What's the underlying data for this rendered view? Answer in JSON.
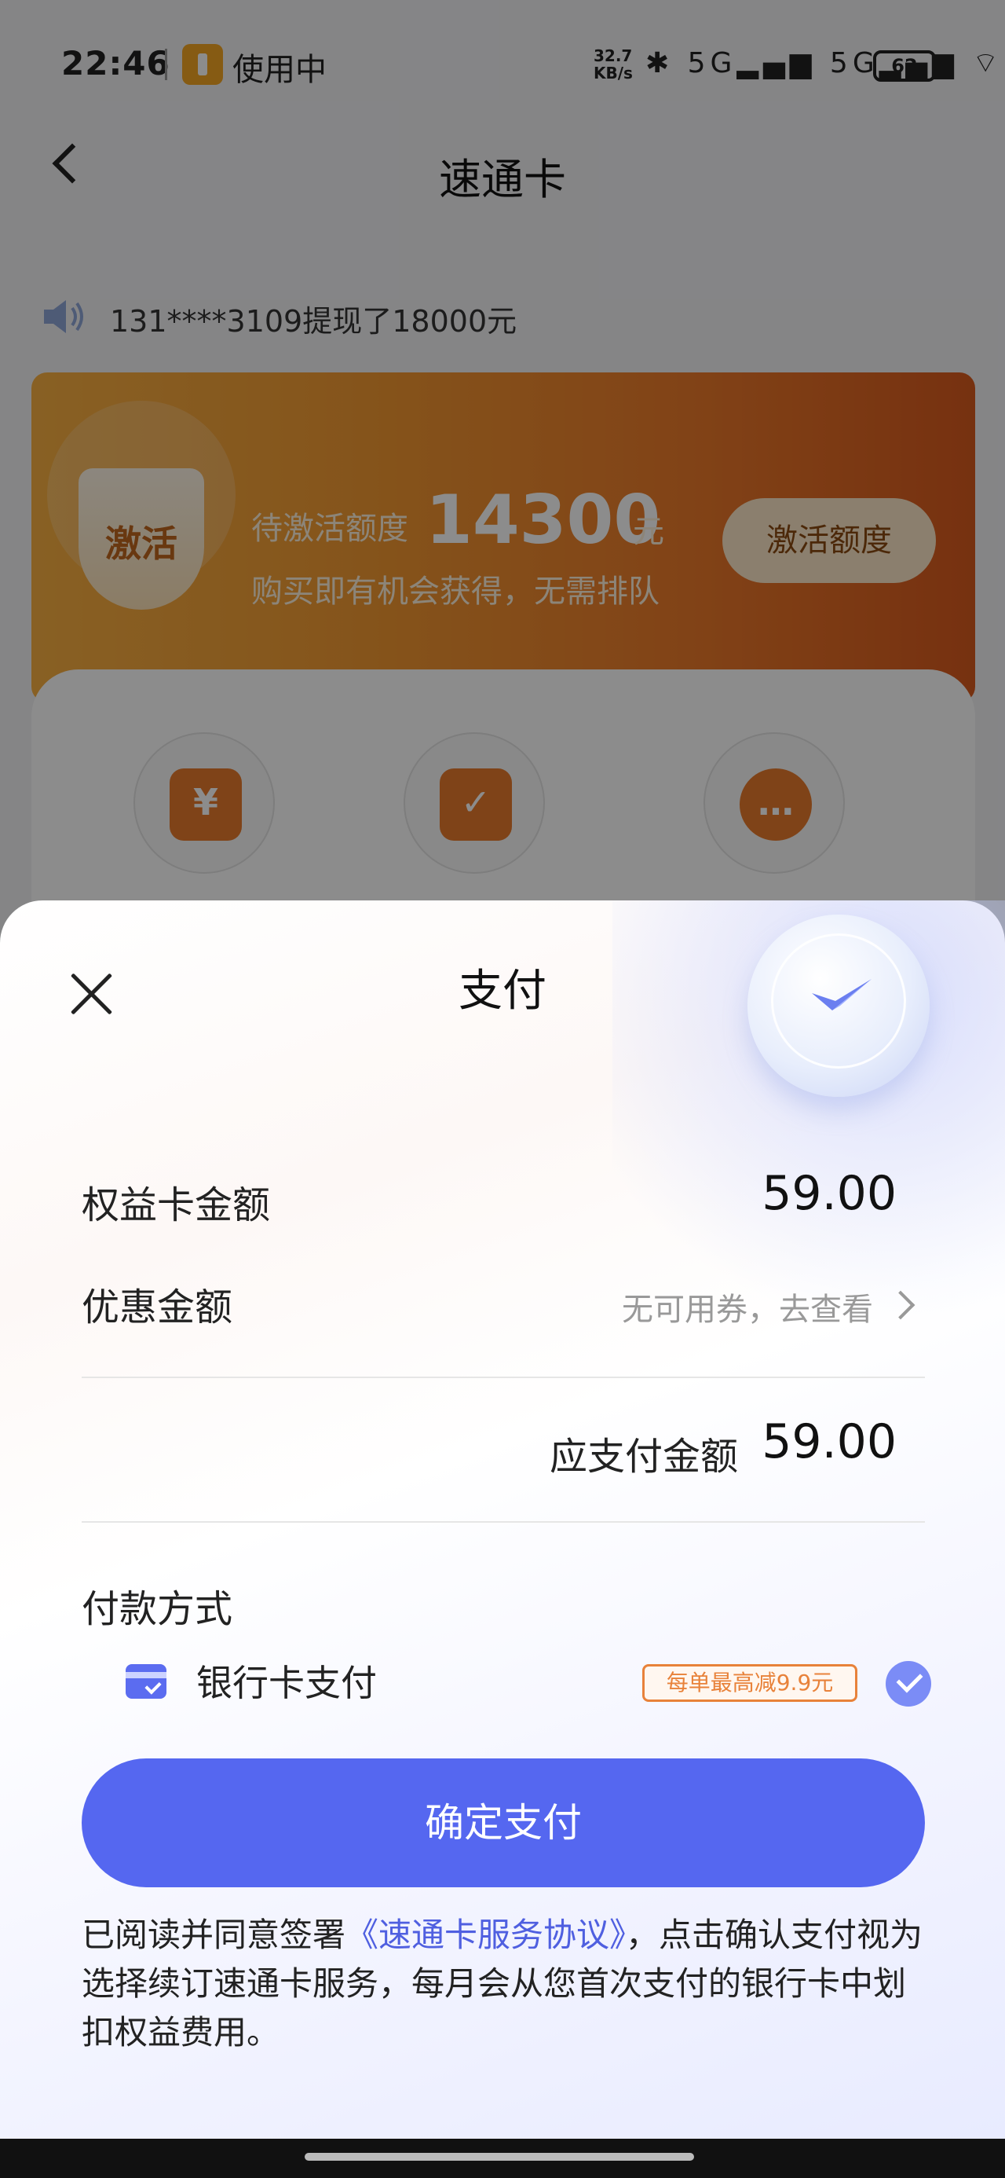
{
  "status_bar": {
    "time": "22:46",
    "app_running": "使用中",
    "net_speed_value": "32.7",
    "net_speed_unit": "KB/s",
    "signal_icons": "✱ 5G▂▄▆ 5G▂▄▆ ⌔",
    "battery": "62"
  },
  "nav": {
    "title": "速通卡"
  },
  "notice": {
    "text": "131****3109提现了18000元"
  },
  "promo_card": {
    "badge": "激活",
    "quota_label": "待激活额度",
    "quota_value": "14300",
    "quota_unit": "元",
    "subtitle": "购买即有机会获得，无需排队",
    "button": "激活额度"
  },
  "services": [
    {
      "icon": "yuan-hand-icon",
      "glyph": "¥"
    },
    {
      "icon": "document-check-icon",
      "glyph": "✓"
    },
    {
      "icon": "customer-service-icon",
      "glyph": "…"
    }
  ],
  "payment_sheet": {
    "title": "支付",
    "card_amount_label": "权益卡金额",
    "card_amount_value": "59.00",
    "discount_label": "优惠金额",
    "discount_value": "无可用券，去查看",
    "payable_label": "应支付金额",
    "payable_value": "59.00",
    "method_section_label": "付款方式",
    "method_name": "银行卡支付",
    "method_promo": "每单最高减9.9元",
    "confirm_button": "确定支付",
    "agreement_prefix": "已阅读并同意签署",
    "agreement_link": "《速通卡服务协议》",
    "agreement_suffix": "，点击确认支付视为选择续订速通卡服务，每月会从您首次支付的银行卡中划扣权益费用。"
  },
  "colors": {
    "primary": "#5567f0",
    "orange": "#ec7a2a",
    "promo_tag": "#e8823a"
  }
}
